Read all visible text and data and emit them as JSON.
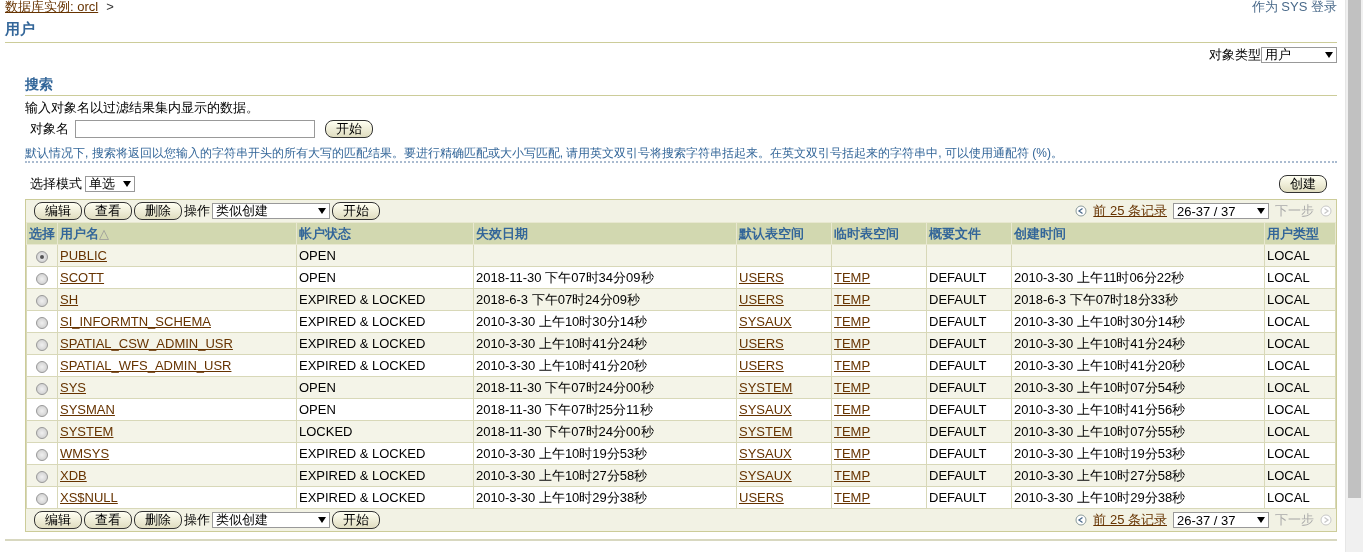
{
  "breadcrumb": {
    "link": "数据库实例: orcl",
    "separator": ">"
  },
  "login_info": "作为 SYS 登录",
  "page_title": "用户",
  "object_type": {
    "label": "对象类型",
    "value": "用户"
  },
  "search": {
    "title": "搜索",
    "instructions": "输入对象名以过滤结果集内显示的数据。",
    "field_label": "对象名",
    "button": "开始",
    "hint": "默认情况下, 搜索将返回以您输入的字符串开头的所有大写的匹配结果。要进行精确匹配或大小写匹配, 请用英文双引号将搜索字符串括起来。在英文双引号括起来的字符串中, 可以使用通配符 (%)。"
  },
  "selection_mode": {
    "label": "选择模式",
    "value": "单选"
  },
  "create_button": "创建",
  "toolbars": [
    {
      "buttons": [
        "编辑",
        "查看",
        "删除"
      ],
      "action_label": "操作",
      "action_value": "类似创建",
      "go": "开始",
      "prev_link": "前 25 条记录",
      "range": "26-37 / 37",
      "next": {
        "label": "下一步",
        "disabled": true
      }
    },
    {
      "buttons": [
        "编辑",
        "查看",
        "删除"
      ],
      "action_label": "操作",
      "action_value": "类似创建",
      "go": "开始",
      "prev_link": "前 25 条记录",
      "range": "26-37 / 37",
      "next": {
        "label": "下一步",
        "disabled": true
      }
    }
  ],
  "table": {
    "columns": [
      {
        "label": "选择"
      },
      {
        "label": "用户名",
        "sort_indicator": "△"
      },
      {
        "label": "帐户状态"
      },
      {
        "label": "失效日期"
      },
      {
        "label": "默认表空间"
      },
      {
        "label": "临时表空间"
      },
      {
        "label": "概要文件"
      },
      {
        "label": "创建时间"
      },
      {
        "label": "用户类型"
      }
    ],
    "rows": [
      {
        "selected": true,
        "name": "PUBLIC",
        "status": "OPEN",
        "expiry": "",
        "default_ts": "",
        "temp_ts": "",
        "profile": "",
        "created": "",
        "type": "LOCAL"
      },
      {
        "selected": false,
        "name": "SCOTT",
        "status": "OPEN",
        "expiry": "2018-11-30 下午07时34分09秒",
        "default_ts": "USERS",
        "temp_ts": "TEMP",
        "profile": "DEFAULT",
        "created": "2010-3-30 上午11时06分22秒",
        "type": "LOCAL"
      },
      {
        "selected": false,
        "name": "SH",
        "status": "EXPIRED & LOCKED",
        "expiry": "2018-6-3 下午07时24分09秒",
        "default_ts": "USERS",
        "temp_ts": "TEMP",
        "profile": "DEFAULT",
        "created": "2018-6-3 下午07时18分33秒",
        "type": "LOCAL"
      },
      {
        "selected": false,
        "name": "SI_INFORMTN_SCHEMA",
        "status": "EXPIRED & LOCKED",
        "expiry": "2010-3-30 上午10时30分14秒",
        "default_ts": "SYSAUX",
        "temp_ts": "TEMP",
        "profile": "DEFAULT",
        "created": "2010-3-30 上午10时30分14秒",
        "type": "LOCAL"
      },
      {
        "selected": false,
        "name": "SPATIAL_CSW_ADMIN_USR",
        "status": "EXPIRED & LOCKED",
        "expiry": "2010-3-30 上午10时41分24秒",
        "default_ts": "USERS",
        "temp_ts": "TEMP",
        "profile": "DEFAULT",
        "created": "2010-3-30 上午10时41分24秒",
        "type": "LOCAL"
      },
      {
        "selected": false,
        "name": "SPATIAL_WFS_ADMIN_USR",
        "status": "EXPIRED & LOCKED",
        "expiry": "2010-3-30 上午10时41分20秒",
        "default_ts": "USERS",
        "temp_ts": "TEMP",
        "profile": "DEFAULT",
        "created": "2010-3-30 上午10时41分20秒",
        "type": "LOCAL"
      },
      {
        "selected": false,
        "name": "SYS",
        "status": "OPEN",
        "expiry": "2018-11-30 下午07时24分00秒",
        "default_ts": "SYSTEM",
        "temp_ts": "TEMP",
        "profile": "DEFAULT",
        "created": "2010-3-30 上午10时07分54秒",
        "type": "LOCAL"
      },
      {
        "selected": false,
        "name": "SYSMAN",
        "status": "OPEN",
        "expiry": "2018-11-30 下午07时25分11秒",
        "default_ts": "SYSAUX",
        "temp_ts": "TEMP",
        "profile": "DEFAULT",
        "created": "2010-3-30 上午10时41分56秒",
        "type": "LOCAL"
      },
      {
        "selected": false,
        "name": "SYSTEM",
        "status": "LOCKED",
        "expiry": "2018-11-30 下午07时24分00秒",
        "default_ts": "SYSTEM",
        "temp_ts": "TEMP",
        "profile": "DEFAULT",
        "created": "2010-3-30 上午10时07分55秒",
        "type": "LOCAL"
      },
      {
        "selected": false,
        "name": "WMSYS",
        "status": "EXPIRED & LOCKED",
        "expiry": "2010-3-30 上午10时19分53秒",
        "default_ts": "SYSAUX",
        "temp_ts": "TEMP",
        "profile": "DEFAULT",
        "created": "2010-3-30 上午10时19分53秒",
        "type": "LOCAL"
      },
      {
        "selected": false,
        "name": "XDB",
        "status": "EXPIRED & LOCKED",
        "expiry": "2010-3-30 上午10时27分58秒",
        "default_ts": "SYSAUX",
        "temp_ts": "TEMP",
        "profile": "DEFAULT",
        "created": "2010-3-30 上午10时27分58秒",
        "type": "LOCAL"
      },
      {
        "selected": false,
        "name": "XS$NULL",
        "status": "EXPIRED & LOCKED",
        "expiry": "2010-3-30 上午10时29分38秒",
        "default_ts": "USERS",
        "temp_ts": "TEMP",
        "profile": "DEFAULT",
        "created": "2010-3-30 上午10时29分38秒",
        "type": "LOCAL"
      }
    ]
  }
}
